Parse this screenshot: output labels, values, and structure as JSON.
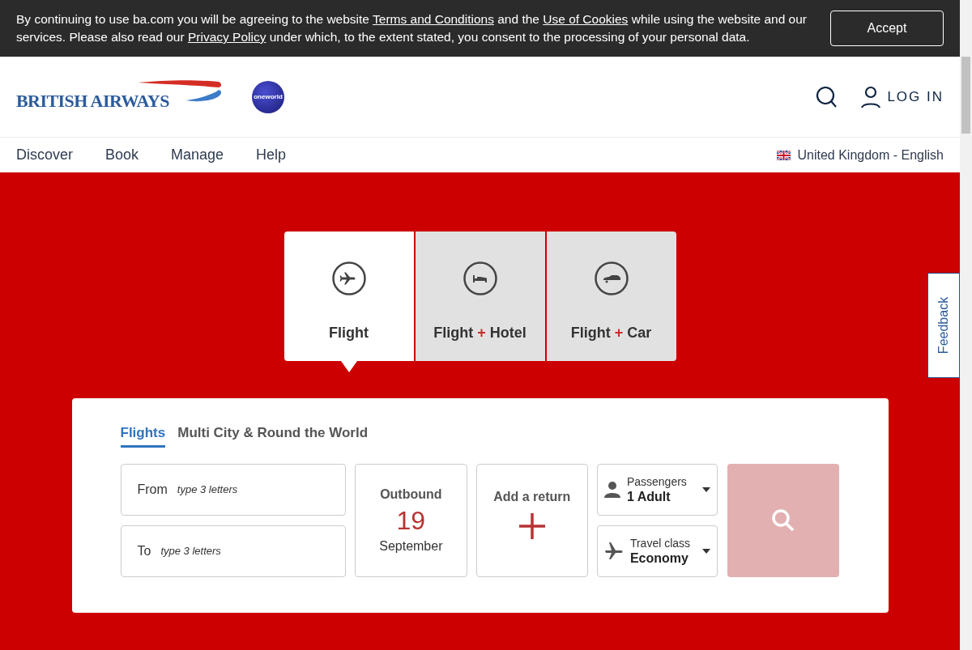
{
  "cookie_banner": {
    "parts": [
      {
        "kind": "text",
        "text": "By continuing to use ba.com you will be agreeing to the website "
      },
      {
        "kind": "link",
        "text": "Terms and Conditions"
      },
      {
        "kind": "text",
        "text": " and the "
      },
      {
        "kind": "link",
        "text": "Use of Cookies"
      },
      {
        "kind": "text",
        "text": " while using the website and our services. Please also read our "
      },
      {
        "kind": "link",
        "text": "Privacy Policy"
      },
      {
        "kind": "text",
        "text": " under which, to the extent stated, you consent to the processing of your personal data."
      }
    ],
    "button": "Accept"
  },
  "header": {
    "logo_text": "BRITISH AIRWAYS",
    "alliance_text": "oneworld",
    "login": "LOG IN"
  },
  "nav": {
    "items": [
      "Discover",
      "Book",
      "Manage",
      "Help"
    ],
    "locale": "United Kingdom - English"
  },
  "product_tabs": [
    {
      "label": "Flight",
      "selected": true,
      "kind": "plane"
    },
    {
      "label": "Flight",
      "joiner": "+",
      "extra": "Hotel",
      "selected": false,
      "kind": "bed"
    },
    {
      "label": "Flight",
      "joiner": "+",
      "extra": "Car",
      "selected": false,
      "kind": "car"
    }
  ],
  "search_form": {
    "tabs": [
      {
        "label": "Flights",
        "selected": true
      },
      {
        "label": "Multi City & Round the World",
        "selected": false
      }
    ],
    "from": {
      "label": "From",
      "placeholder": "type 3 letters"
    },
    "to": {
      "label": "To",
      "placeholder": "type 3 letters"
    },
    "outbound": {
      "label": "Outbound",
      "day": "19",
      "month": "September"
    },
    "add_return": "Add a return",
    "passengers": {
      "label": "Passengers",
      "value": "1 Adult"
    },
    "travel_class": {
      "label": "Travel class",
      "value": "Economy"
    }
  },
  "feedback": "Feedback"
}
